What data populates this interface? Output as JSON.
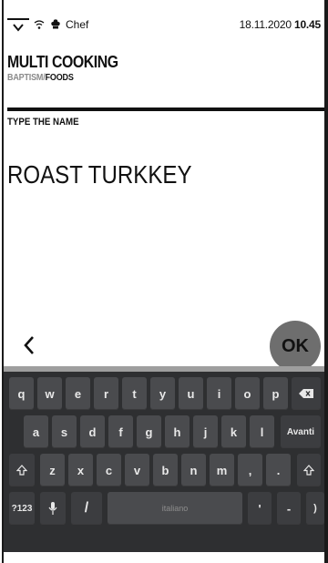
{
  "status_bar": {
    "user": "Chef",
    "date": "18.11.2020",
    "time": "10.45"
  },
  "header": {
    "title": "MULTI COOKING",
    "breadcrumb_parent": "BAPTISM/",
    "breadcrumb_current": "FOODS"
  },
  "form": {
    "field_label": "TYPE THE NAME",
    "field_value": "ROAST TURKKEY"
  },
  "actions": {
    "ok_label": "OK"
  },
  "keyboard": {
    "row1": [
      "q",
      "w",
      "e",
      "r",
      "t",
      "y",
      "u",
      "i",
      "o",
      "p"
    ],
    "row2": [
      "a",
      "s",
      "d",
      "f",
      "g",
      "h",
      "j",
      "k",
      "l"
    ],
    "row3": [
      "z",
      "x",
      "c",
      "v",
      "b",
      "n",
      "m",
      ",",
      "."
    ],
    "enter_label": "Avanti",
    "symbols_label": "?123",
    "slash_label": "/",
    "space_label": "italiano",
    "apostrophe_label": "'",
    "dash_label": "-",
    "paren_label": ")"
  },
  "icons": {
    "menu": "menu-chevron-icon",
    "wifi": "wifi-icon",
    "chef": "chef-hat-icon",
    "back": "chevron-left-icon",
    "backspace": "backspace-icon",
    "shift": "shift-icon",
    "mic": "mic-icon"
  },
  "colors": {
    "ok_button": "#6e6e6e",
    "keyboard_bg": "#2e2f31",
    "key_bg": "#4a4b4e",
    "breadcrumb_parent": "#8a8a8a"
  }
}
